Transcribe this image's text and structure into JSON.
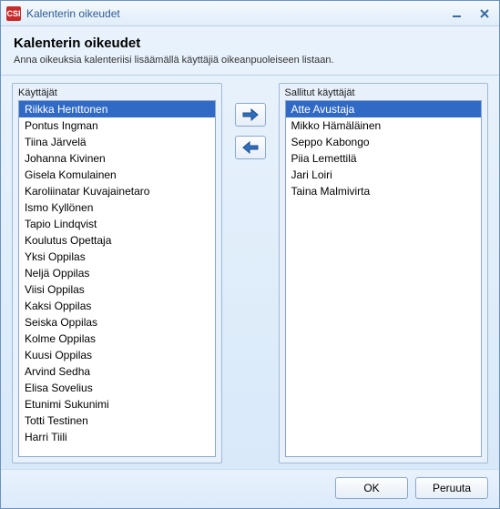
{
  "window": {
    "title": "Kalenterin oikeudet",
    "app_icon_text": "CSI"
  },
  "header": {
    "title": "Kalenterin oikeudet",
    "instruction": "Anna oikeuksia kalenteriisi lisäämällä käyttäjiä oikeanpuoleiseen listaan."
  },
  "left_list": {
    "label": "Käyttäjät",
    "items": [
      "Riikka Henttonen",
      "Pontus Ingman",
      "Tiina Järvelä",
      "Johanna Kivinen",
      "Gisela Komulainen",
      "Karoliinatar Kuvajainetaro",
      "Ismo Kyllönen",
      "Tapio Lindqvist",
      "Koulutus Opettaja",
      "Yksi Oppilas",
      "Neljä Oppilas",
      "Viisi Oppilas",
      "Kaksi Oppilas",
      "Seiska Oppilas",
      "Kolme Oppilas",
      "Kuusi Oppilas",
      "Arvind Sedha",
      "Elisa Sovelius",
      "Etunimi Sukunimi",
      "Totti Testinen",
      "Harri Tiili"
    ],
    "selected_index": 0
  },
  "right_list": {
    "label": "Sallitut käyttäjät",
    "items": [
      "Atte Avustaja",
      "Mikko Hämäläinen",
      "Seppo Kabongo",
      "Piia Lemettilä",
      "Jari Loiri",
      "Taina Malmivirta"
    ],
    "selected_index": 0
  },
  "buttons": {
    "ok": "OK",
    "cancel": "Peruuta"
  }
}
